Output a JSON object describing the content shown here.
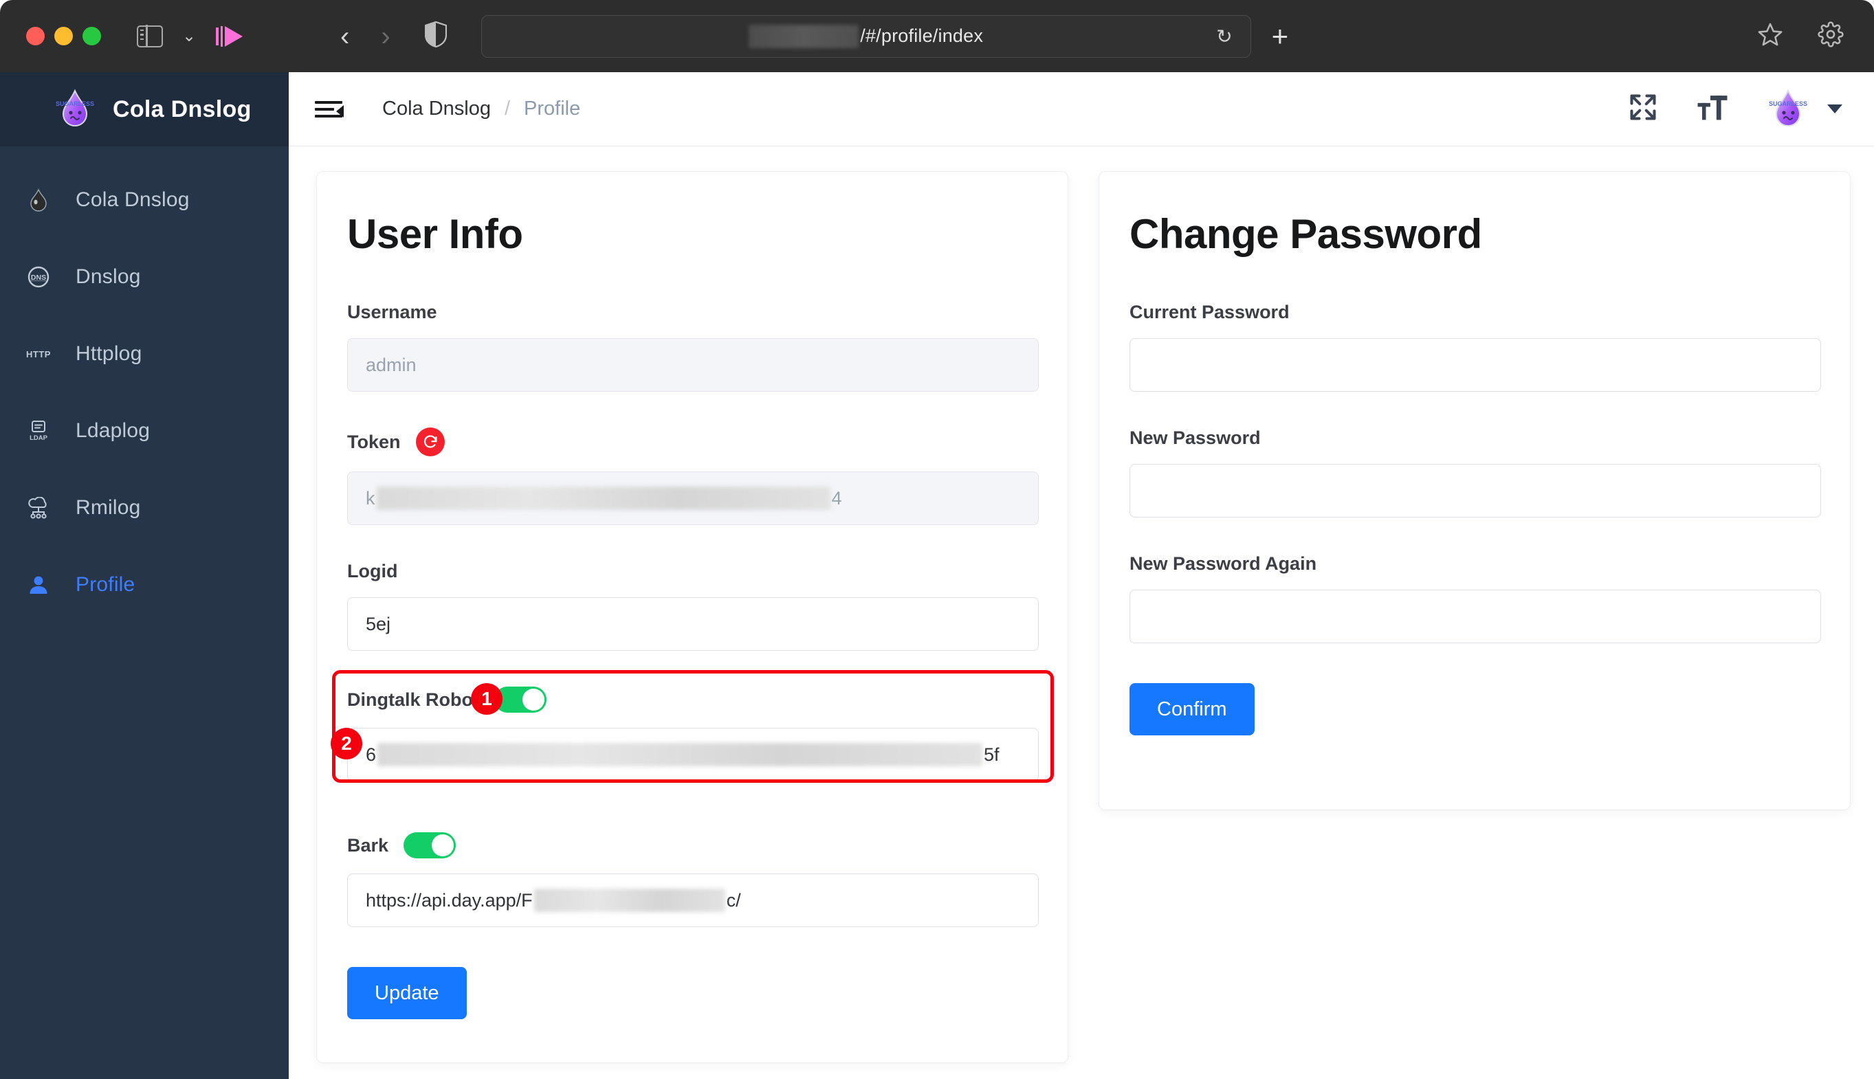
{
  "browser": {
    "traffic_lights": [
      "close",
      "minimize",
      "maximize"
    ],
    "sidebar_toggle_label": "sidebar-toggle",
    "url_suffix": "/#/profile/index",
    "url_redacted": true,
    "reload_glyph": "↻",
    "new_tab_glyph": "+",
    "back_glyph": "‹",
    "forward_glyph": "›",
    "bookmark_icon": "star-icon",
    "settings_icon": "gear-icon",
    "shield_icon": "shield-icon",
    "media_icon": "media-playback-icon"
  },
  "sidebar": {
    "brand": "Cola Dnslog",
    "logo": "sugarless-cola-drop-logo",
    "items": [
      {
        "label": "Cola Dnslog",
        "icon": "cola-drop-icon",
        "active": false
      },
      {
        "label": "Dnslog",
        "icon": "dns-globe-icon",
        "active": false
      },
      {
        "label": "Httplog",
        "icon": "http-icon",
        "active": false
      },
      {
        "label": "Ldaplog",
        "icon": "ldap-icon",
        "active": false
      },
      {
        "label": "Rmilog",
        "icon": "rmi-cloud-icon",
        "active": false
      },
      {
        "label": "Profile",
        "icon": "user-icon",
        "active": true
      }
    ]
  },
  "header": {
    "collapse_icon": "collapse-menu-icon",
    "breadcrumb": {
      "root": "Cola Dnslog",
      "separator": "/",
      "current": "Profile"
    },
    "fullscreen_icon": "fullscreen-expand-icon",
    "fontsize_icon": "font-size-icon",
    "avatar_icon": "sugarless-cola-drop-avatar",
    "avatar_caret_icon": "chevron-down-icon"
  },
  "user_info": {
    "title": "User Info",
    "username": {
      "label": "Username",
      "value": "admin",
      "readonly": true
    },
    "token": {
      "label": "Token",
      "refresh_icon": "refresh-icon",
      "value_prefix": "k",
      "value_suffix": "4",
      "redacted": true,
      "readonly": true
    },
    "logid": {
      "label": "Logid",
      "value": "5ej"
    },
    "dingtalk": {
      "label": "Dingtalk Robot",
      "enabled": true,
      "value_prefix": "6",
      "value_suffix": "5f",
      "redacted": true
    },
    "bark": {
      "label": "Bark",
      "enabled": true,
      "value_prefix": "https://api.day.app/F",
      "value_suffix": "c/",
      "redacted": true
    },
    "update_button": "Update"
  },
  "change_password": {
    "title": "Change Password",
    "fields": [
      {
        "label": "Current Password",
        "value": ""
      },
      {
        "label": "New Password",
        "value": ""
      },
      {
        "label": "New Password Again",
        "value": ""
      }
    ],
    "confirm_button": "Confirm"
  },
  "annotations": [
    {
      "id": "1",
      "target": "dingtalk-toggle"
    },
    {
      "id": "2",
      "target": "dingtalk-webhook-input"
    }
  ],
  "colors": {
    "accent_blue": "#1677ff",
    "sidebar_bg": "#273549",
    "sidebar_header_bg": "#1f2c3d",
    "toggle_on": "#13ce66",
    "annotation_red": "#f5000f",
    "refresh_red": "#f5222d",
    "active_nav": "#3d7eff"
  }
}
